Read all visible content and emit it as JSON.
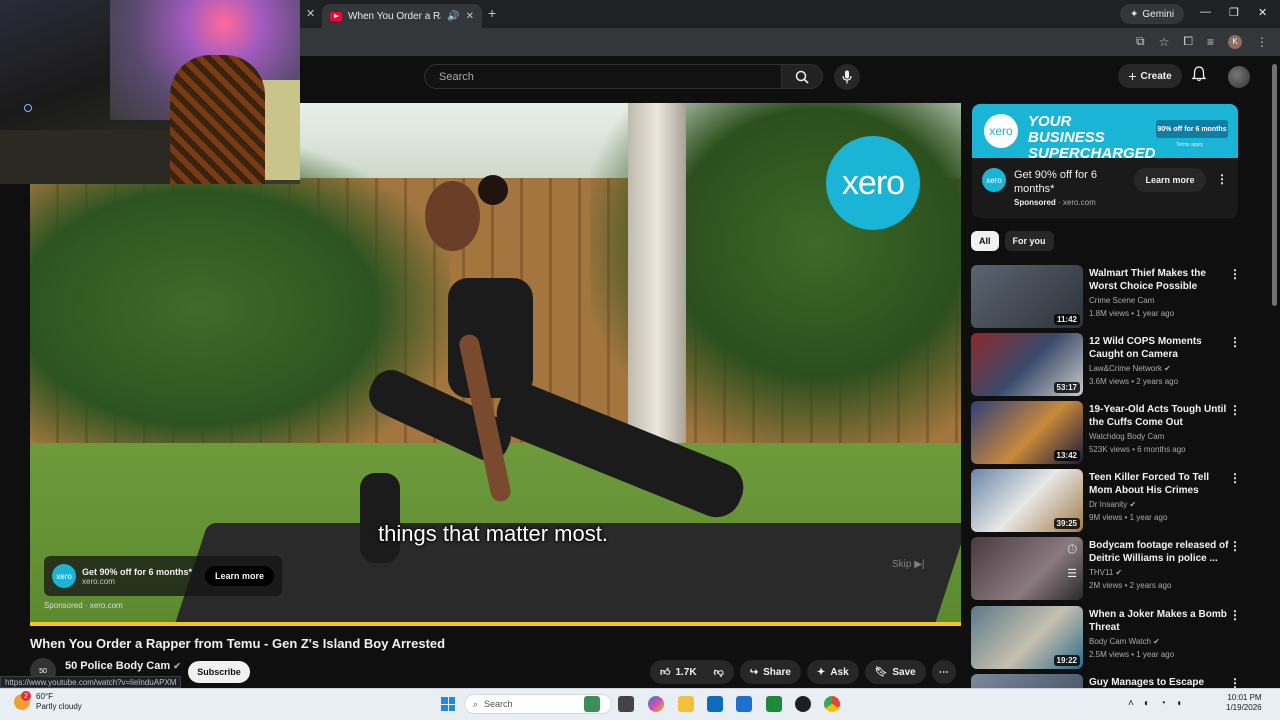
{
  "browser": {
    "tab_title": "When You Order a Rapper f",
    "gemini_label": "Gemini",
    "profile_initial": "K",
    "status_url": "https://www.youtube.com/watch?v=lieInduAPXM"
  },
  "header": {
    "search_placeholder": "Search",
    "create_label": "Create"
  },
  "video": {
    "caption": "things that matter most.",
    "overlay_logo": "xero",
    "ad_title": "Get 90% off for 6 months*",
    "ad_domain": "xero.com",
    "ad_learn_more": "Learn more",
    "sponsored_text": "Sponsored · xero.com",
    "skip_label": "Skip ▶|",
    "title": "When You Order a Rapper from Temu - Gen Z's Island Boy Arrested",
    "channel_avatar_text": "50",
    "channel_name": "50 Police Body Cam",
    "subscribe_label": "Subscribe",
    "likes": "1.7K",
    "share_label": "Share",
    "ask_label": "Ask",
    "save_label": "Save"
  },
  "sidebar_ad": {
    "banner_logo": "xero",
    "banner_headline": "YOUR BUSINESS SUPERCHARGED",
    "banner_offer": "90% off for 6 months",
    "banner_terms": "Terms apply",
    "logo": "xero",
    "title": "Get 90% off for 6 months*",
    "sponsored": "Sponsored",
    "domain": "xero.com",
    "learn_more": "Learn more"
  },
  "chips": [
    "All",
    "For you"
  ],
  "recommendations": [
    {
      "title": "Walmart Thief Makes the Worst Choice Possible",
      "channel": "Crime Scene Cam",
      "meta": "1.8M views • 1 year ago",
      "duration": "11:42",
      "thumb_color": "#5b6470"
    },
    {
      "title": "12 Wild COPS Moments Caught on Camera",
      "channel": "Law&Crime Network ✔",
      "meta": "3.6M views • 2 years ago",
      "duration": "53:17",
      "thumb_color": "#3a4a6b"
    },
    {
      "title": "19-Year-Old Acts Tough Until the Cuffs Come Out",
      "channel": "Watchdog Body Cam",
      "meta": "523K views • 6 months ago",
      "duration": "13:42",
      "thumb_color": "#2f3f7a"
    },
    {
      "title": "Teen Killer Forced To Tell Mom About His Crimes",
      "channel": "Dr Insanity ✔",
      "meta": "9M views • 1 year ago",
      "duration": "39:25",
      "thumb_color": "#6a86a8"
    },
    {
      "title": "Bodycam footage released of Deitric Williams in police ...",
      "channel": "THV11 ✔",
      "meta": "2M views • 2 years ago",
      "duration": "",
      "thumb_color": "#4a3a3f"
    },
    {
      "title": "When a Joker Makes a Bomb Threat",
      "channel": "Body Cam Watch ✔",
      "meta": "2.5M views • 1 year ago",
      "duration": "19:22",
      "thumb_color": "#5a7a8a"
    },
    {
      "title": "Guy Manages to Escape Police",
      "channel": "",
      "meta": "",
      "duration": "",
      "thumb_color": "#7a8a9a"
    }
  ],
  "taskbar": {
    "weather_badge": "2",
    "temperature": "60°F",
    "condition": "Partly cloudy",
    "search_placeholder": "Search",
    "time": "10:01 PM",
    "date": "1/19/2026"
  }
}
